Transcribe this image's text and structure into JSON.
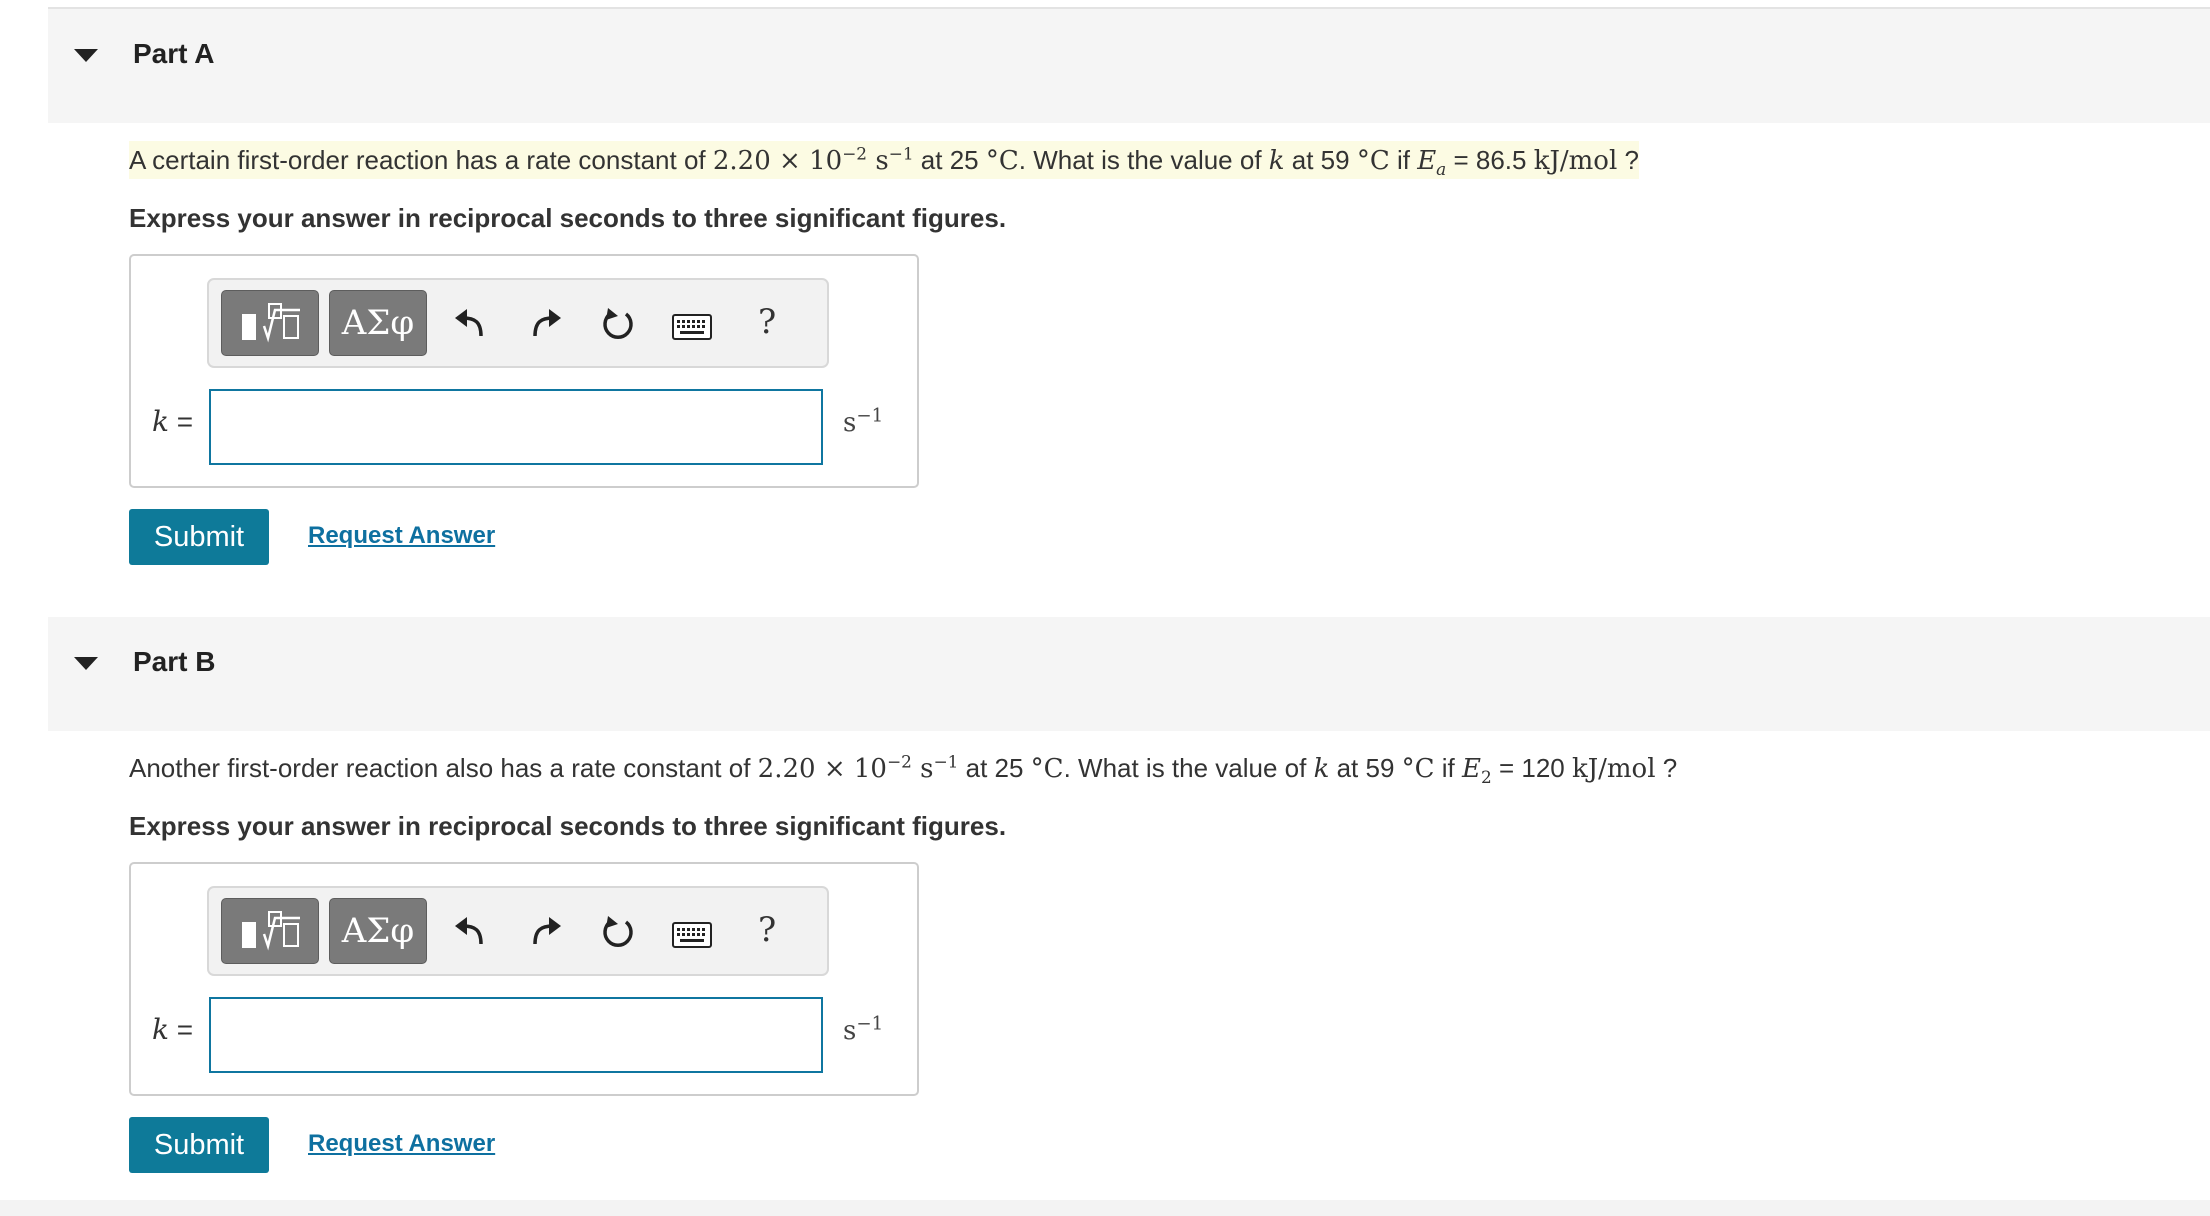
{
  "parts": [
    {
      "title": "Part A",
      "question": {
        "intro": "A certain first-order reaction has a rate constant of ",
        "k_mant": "2.20",
        "times": " × 10",
        "exp": "−2",
        "s_unit": " s",
        "s_exp": "−1",
        "t1_pre": " at 25 ",
        "t1_unit": "°C",
        "mid": ". What is the value of ",
        "kvar": "k",
        "t2_pre": " at 59 ",
        "t2_unit": "°C",
        "if_text": " if ",
        "evar": "E",
        "esub": "a",
        "eq_val": " = 86.5 ",
        "e_unit": "kJ/mol",
        "qmark": " ?"
      },
      "instruction": "Express your answer in reciprocal seconds to three significant figures.",
      "answer_label": {
        "var": "k",
        "eq": " ="
      },
      "answer_value": "",
      "unit": "s",
      "unit_exp": "−1",
      "submit_label": "Submit",
      "request_label": "Request Answer"
    },
    {
      "title": "Part B",
      "question": {
        "intro": "Another first-order reaction also has a rate constant of ",
        "k_mant": "2.20",
        "times": " × 10",
        "exp": "−2",
        "s_unit": " s",
        "s_exp": "−1",
        "t1_pre": " at 25 ",
        "t1_unit": "°C",
        "mid": ". What is the value of ",
        "kvar": "k",
        "t2_pre": " at 59 ",
        "t2_unit": "°C",
        "if_text": " if ",
        "evar": "E",
        "esub": "2",
        "eq_val": " = 120 ",
        "e_unit": "kJ/mol",
        "qmark": " ?"
      },
      "instruction": "Express your answer in reciprocal seconds to three significant figures.",
      "answer_label": {
        "var": "k",
        "eq": " ="
      },
      "answer_value": "",
      "unit": "s",
      "unit_exp": "−1",
      "submit_label": "Submit",
      "request_label": "Request Answer"
    }
  ],
  "toolbar": {
    "templates_icon": "templates-icon",
    "greek_label": "ΑΣφ",
    "undo_icon": "undo-icon",
    "redo_icon": "redo-icon",
    "reset_icon": "reset-icon",
    "keyboard_icon": "keyboard-icon",
    "help_label": "?"
  },
  "colors": {
    "submit_bg": "#0e7a99",
    "link": "#0e70a0",
    "input_border": "#0f76a0",
    "highlight": "#fcfbe3",
    "header_bg": "#f5f5f5"
  }
}
